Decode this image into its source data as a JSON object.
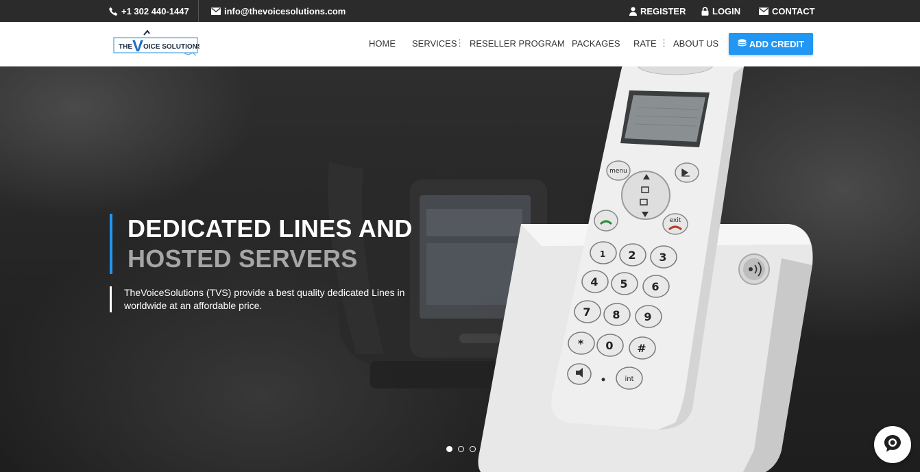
{
  "topbar": {
    "phone": "+1 302 440-1447",
    "email": "info@thevoicesolutions.com",
    "register": "REGISTER",
    "login": "LOGIN",
    "contact": "CONTACT"
  },
  "logo": {
    "text_the": "THE",
    "text_v": "V",
    "text_rest": "OICE SOLUTIONS"
  },
  "nav": {
    "home": "HOME",
    "services": "SERVICES",
    "reseller": "RESELLER PROGRAM",
    "packages": "PACKAGES",
    "rate": "RATE",
    "about": "ABOUT US",
    "add_credit": "ADD CREDIT"
  },
  "hero": {
    "title_line1": "DEDICATED LINES AND",
    "title_line2": "HOSTED SERVERS",
    "description": "TheVoiceSolutions (TVS) provide a best quality dedicated Lines in worldwide at an affordable price.",
    "active_slide": 1,
    "slide_count": 3
  },
  "keypad": {
    "menu": "menu",
    "exit": "exit",
    "int": "int",
    "keys": [
      "1",
      "2",
      "3",
      "4",
      "5",
      "6",
      "7",
      "8",
      "9",
      "*",
      "0",
      "#"
    ]
  },
  "colors": {
    "topbar_bg": "#2b2b2b",
    "accent": "#2196f3",
    "title_secondary": "#a6a6a6"
  },
  "icons": {
    "phone": "phone-icon",
    "email": "envelope-icon",
    "register": "user-icon",
    "login": "lock-icon",
    "contact": "envelope-icon",
    "add_credit": "coins-icon",
    "chat": "chat-bubble-icon"
  }
}
